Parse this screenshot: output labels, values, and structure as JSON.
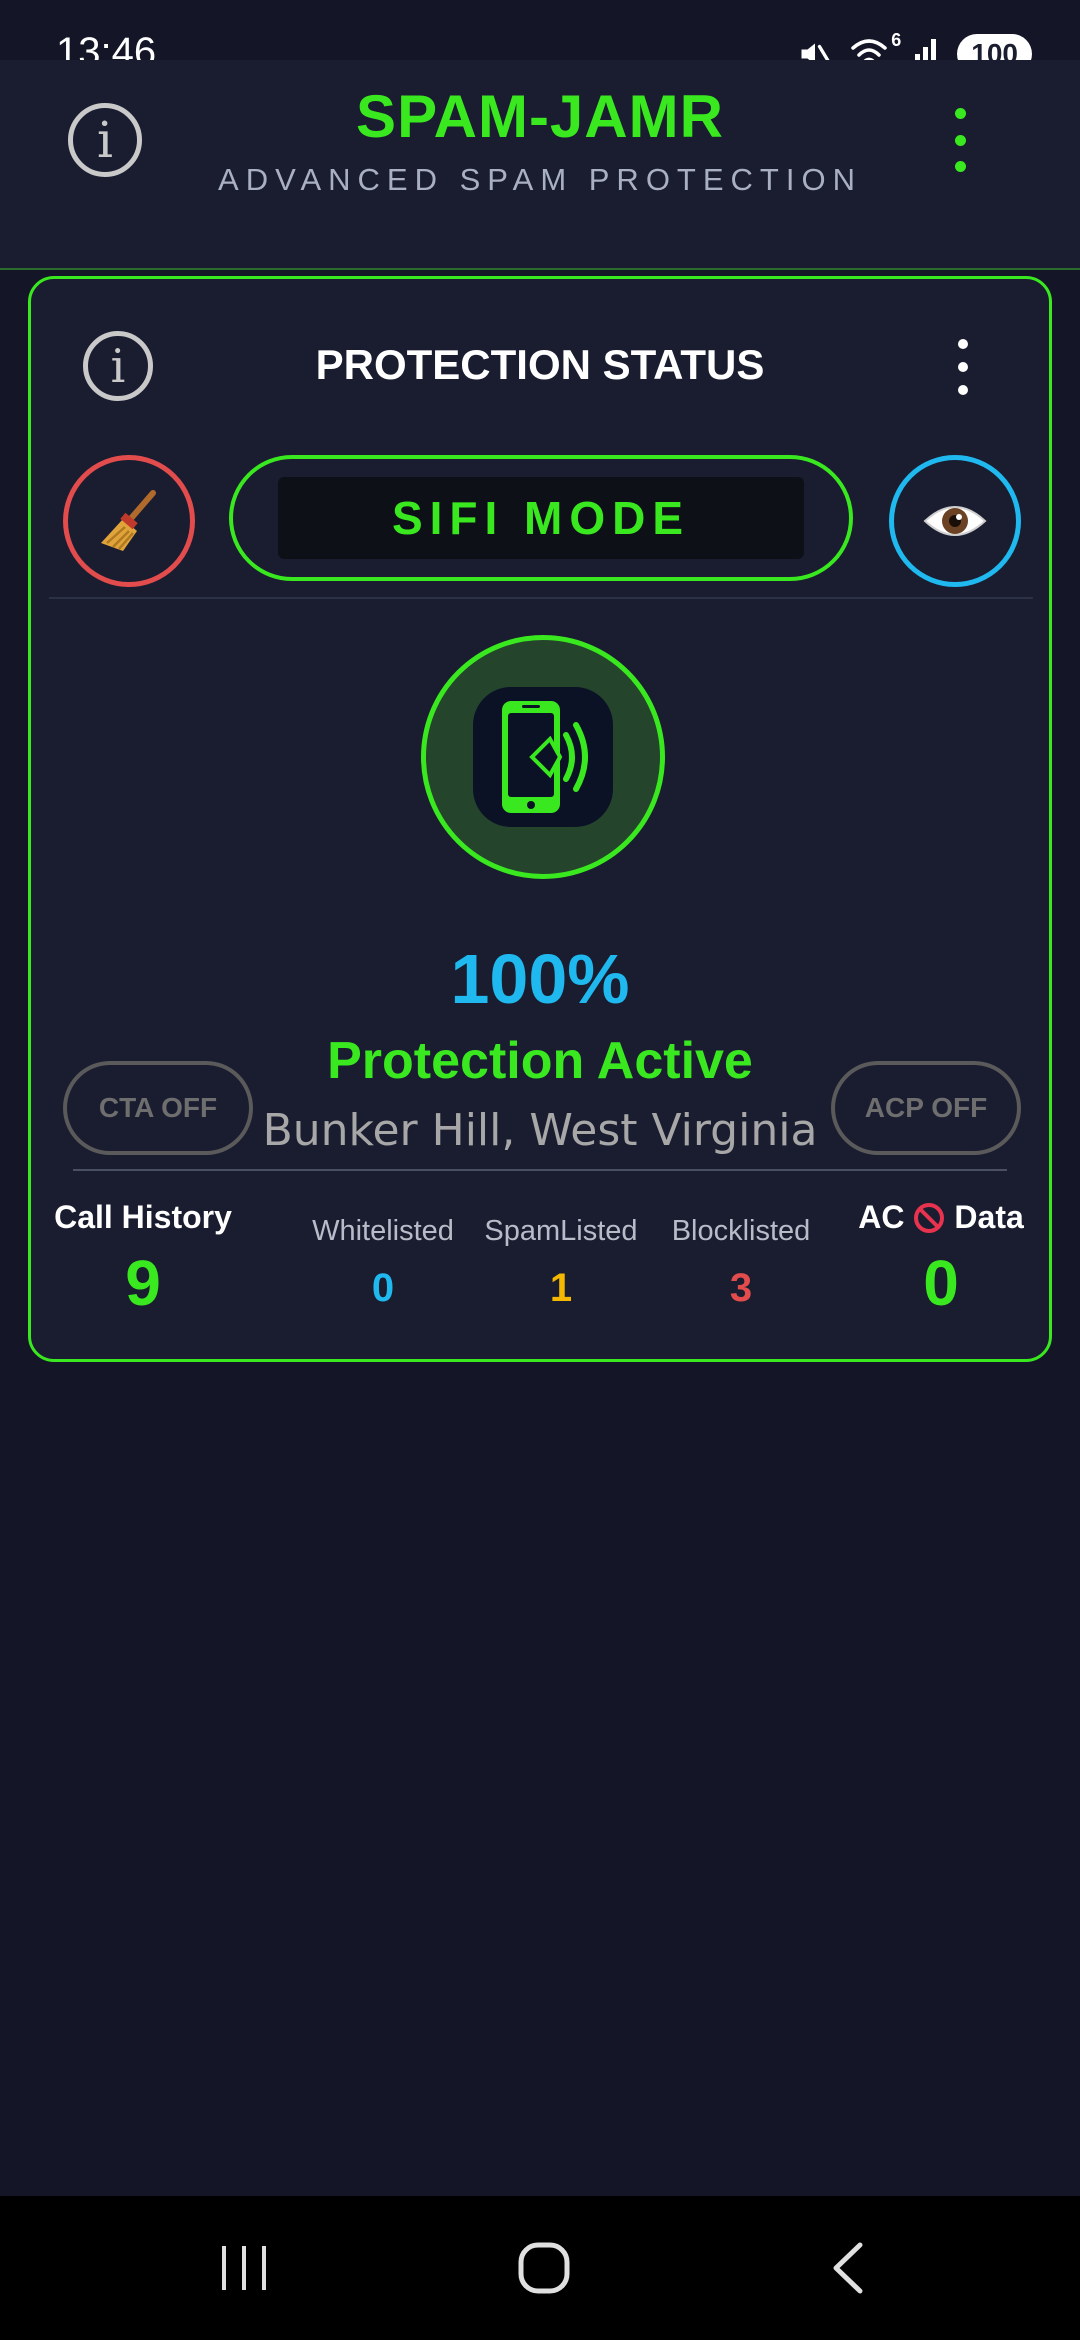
{
  "status_bar": {
    "time": "13:46",
    "battery": "100",
    "network_badge": "6"
  },
  "header": {
    "title": "SPAM-JAMR",
    "subtitle": "ADVANCED SPAM PROTECTION",
    "info_icon": "info-icon",
    "menu_icon": "kebab-menu-icon"
  },
  "card": {
    "title": "PROTECTION STATUS",
    "mode_label": "SIFI MODE",
    "clean_icon": "broom-icon",
    "eye_icon": "eye-icon",
    "protection_percent": "100%",
    "protection_status": "Protection Active",
    "location": "Bunker Hill, West Virginia",
    "cta_label": "CTA OFF",
    "acp_label": "ACP OFF"
  },
  "stats": {
    "call_history": {
      "label": "Call History",
      "value": "9"
    },
    "whitelisted": {
      "label": "Whitelisted",
      "value": "0"
    },
    "spamlisted": {
      "label": "SpamListed",
      "value": "1"
    },
    "blocklisted": {
      "label": "Blocklisted",
      "value": "3"
    },
    "ac_data": {
      "label_prefix": "AC",
      "label_suffix": "Data",
      "value": "0"
    }
  },
  "colors": {
    "accent_green": "#39e81f",
    "accent_blue": "#1fb9f0",
    "accent_red": "#e24c4c",
    "accent_yellow": "#f5b800",
    "background": "#141628",
    "card_background": "#1a1d30"
  }
}
